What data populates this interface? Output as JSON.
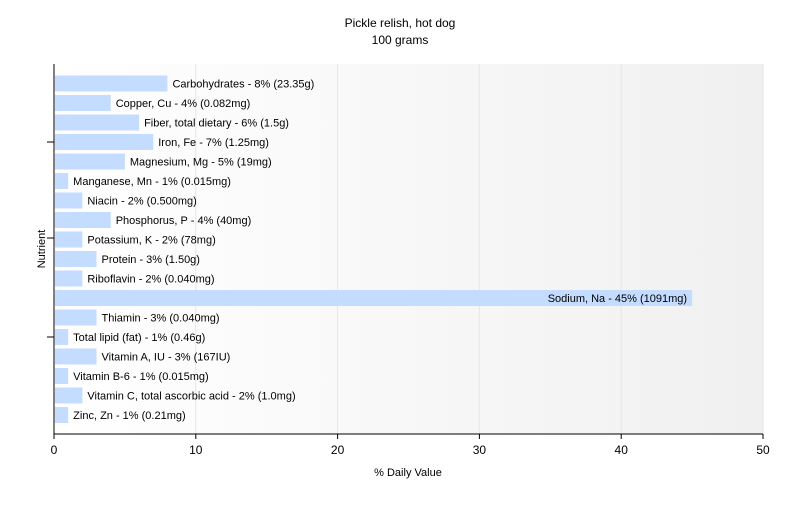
{
  "chart_data": {
    "type": "bar",
    "orientation": "horizontal",
    "title": "Pickle relish, hot dog",
    "subtitle": "100 grams",
    "xlabel": "% Daily Value",
    "ylabel": "Nutrient",
    "xlim": [
      0,
      50
    ],
    "xticks": [
      "0",
      "10",
      "20",
      "30",
      "40",
      "50"
    ],
    "grid": true,
    "legend": "none",
    "bar_color": "#c4dcff",
    "categories": [
      "Carbohydrates",
      "Copper, Cu",
      "Fiber, total dietary",
      "Iron, Fe",
      "Magnesium, Mg",
      "Manganese, Mn",
      "Niacin",
      "Phosphorus, P",
      "Potassium, K",
      "Protein",
      "Riboflavin",
      "Sodium, Na",
      "Thiamin",
      "Total lipid (fat)",
      "Vitamin A, IU",
      "Vitamin B-6",
      "Vitamin C, total ascorbic acid",
      "Zinc, Zn"
    ],
    "values": [
      8,
      4,
      6,
      7,
      5,
      1,
      2,
      4,
      2,
      3,
      2,
      45,
      3,
      1,
      3,
      1,
      2,
      1
    ],
    "labels": [
      "Carbohydrates - 8% (23.35g)",
      "Copper, Cu - 4% (0.082mg)",
      "Fiber, total dietary - 6% (1.5g)",
      "Iron, Fe - 7% (1.25mg)",
      "Magnesium, Mg - 5% (19mg)",
      "Manganese, Mn - 1% (0.015mg)",
      "Niacin - 2% (0.500mg)",
      "Phosphorus, P - 4% (40mg)",
      "Potassium, K - 2% (78mg)",
      "Protein - 3% (1.50g)",
      "Riboflavin - 2% (0.040mg)",
      "Sodium, Na - 45% (1091mg)",
      "Thiamin - 3% (0.040mg)",
      "Total lipid (fat) - 1% (0.46g)",
      "Vitamin A, IU - 3% (167IU)",
      "Vitamin B-6 - 1% (0.015mg)",
      "Vitamin C, total ascorbic acid - 2% (1.0mg)",
      "Zinc, Zn - 1% (0.21mg)"
    ]
  }
}
